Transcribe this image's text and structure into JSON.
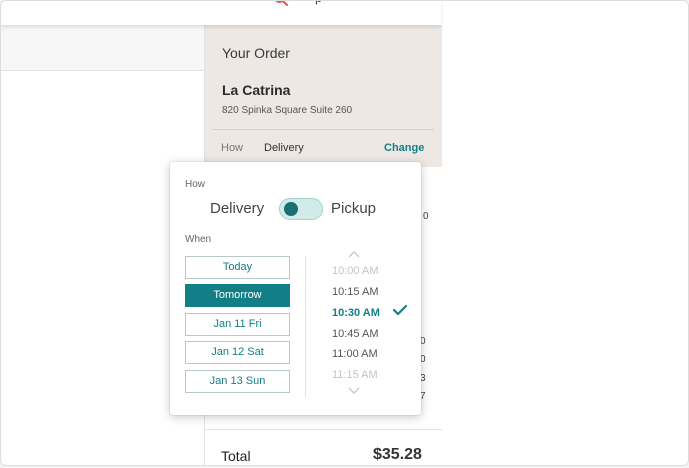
{
  "header": {
    "logo_text": "p",
    "logo_icon": "magnifier-logo-icon"
  },
  "order": {
    "title": "Your Order",
    "restaurant_name": "La Catrina",
    "restaurant_address": "820 Spinka Square Suite 260",
    "how_label": "How",
    "how_value": "Delivery",
    "change_label": "Change",
    "total_label": "Total",
    "total_value": "$35.28"
  },
  "partial_values": [
    "0",
    "0",
    "0",
    "3",
    "7"
  ],
  "popover": {
    "how_label": "How",
    "option_delivery": "Delivery",
    "option_pickup": "Pickup",
    "when_label": "When",
    "days": [
      "Today",
      "Tomorrow",
      "Jan 11 Fri",
      "Jan 12 Sat",
      "Jan 13 Sun"
    ],
    "selected_day": "Tomorrow",
    "times": [
      "10:00 AM",
      "10:15 AM",
      "10:30 AM",
      "10:45 AM",
      "11:00 AM",
      "11:15 AM"
    ],
    "selected_time": "10:30 AM"
  },
  "colors": {
    "accent": "#127f86",
    "order_header_bg": "#ede8e4",
    "toggle_track": "#d1ece8",
    "toggle_knob": "#1a6f72",
    "logo": "#e8604c"
  }
}
